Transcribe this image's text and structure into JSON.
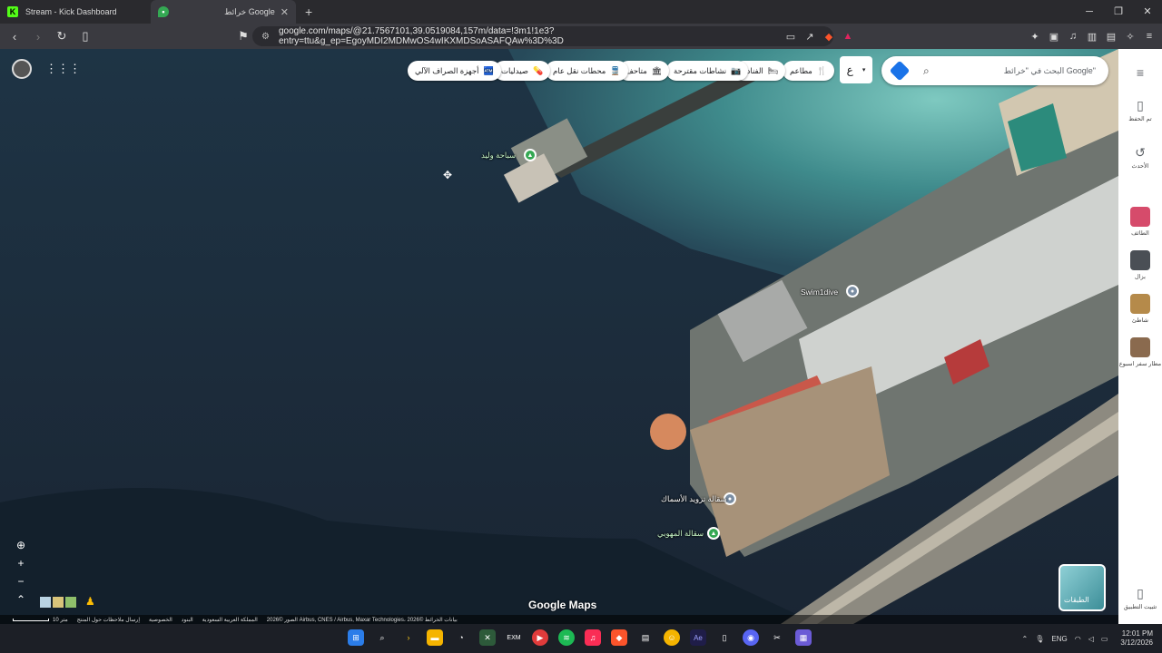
{
  "browser": {
    "tabs": [
      {
        "title": "Stream - Kick Dashboard",
        "favicon": "kick-icon",
        "active": false
      },
      {
        "title": "خرائط Google",
        "favicon": "google-maps-icon",
        "active": true
      }
    ],
    "url": "google.com/maps/@21.7567101,39.0519084,157m/data=!3m1!1e3?entry=ttu&g_ep=EgoyMDI2MDMwOS4wIKXMDSoASAFQAw%3D%3D",
    "window_controls": [
      "─",
      "❐",
      "✕"
    ]
  },
  "maps": {
    "search_placeholder": "البحث في \"خرائط Google\"",
    "language_selector": "ع",
    "category_chips": [
      {
        "label": "مطاعم",
        "icon": "🍴"
      },
      {
        "label": "الفنادق",
        "icon": "🛏"
      },
      {
        "label": "نشاطات مقترحة",
        "icon": "📷"
      },
      {
        "label": "متاحف",
        "icon": "🏛"
      },
      {
        "label": "محطات نقل عام",
        "icon": "🚆"
      },
      {
        "label": "صيدليات",
        "icon": "💊"
      },
      {
        "label": "أجهزة الصراف الآلي",
        "icon": "🏧"
      }
    ],
    "places": [
      {
        "label": "سباحة وليد",
        "color": "#34a853"
      },
      {
        "label": "Swim1dive",
        "color": "#7b8ea3"
      },
      {
        "label": "سقالة تزويد الأسماك",
        "color": "#7b8ea3"
      },
      {
        "label": "سقالة المهوبي",
        "color": "#34a853"
      }
    ],
    "logo": "Google Maps",
    "layers_label": "الطبقات",
    "attribution": {
      "imagery": "الصور ©2026 Airbus, CNES / Airbus, Maxar Technologies، بيانات الخرائط ©2026",
      "region": "المملكة العربية السعودية",
      "terms": "البنود",
      "privacy": "الخصوصية",
      "feedback": "إرسال ملاحظات حول المنتج",
      "scale": "10 متر"
    }
  },
  "sidepanel": {
    "items": [
      {
        "label": "تم الحفظ",
        "icon": "bookmark-icon"
      },
      {
        "label": "الأحدث",
        "icon": "history-icon"
      },
      {
        "label": "الطائف",
        "icon": "thumbnail"
      },
      {
        "label": "بزال",
        "icon": "thumbnail"
      },
      {
        "label": "شاطئ",
        "icon": "thumbnail"
      },
      {
        "label": "مطار سفر اسبوع",
        "icon": "thumbnail"
      },
      {
        "label": "تثبيت التطبيق",
        "icon": "phone-icon"
      }
    ]
  },
  "taskbar": {
    "language": "ENG",
    "time": "12:01 PM",
    "date": "3/12/2026"
  }
}
